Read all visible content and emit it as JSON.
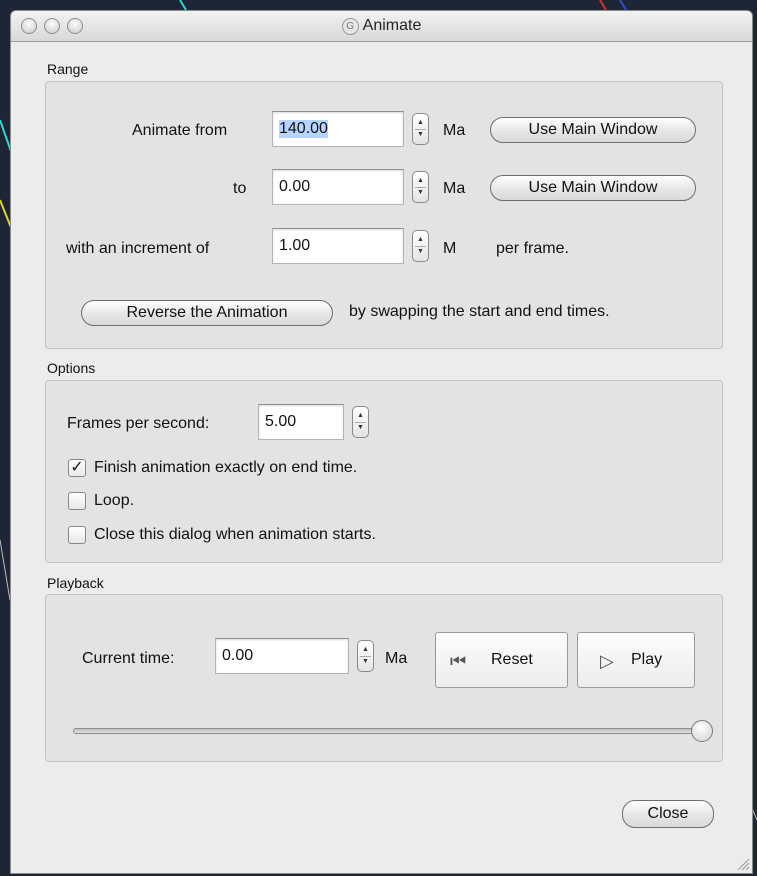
{
  "window": {
    "title": "Animate"
  },
  "range": {
    "label": "Range",
    "from_label": "Animate from",
    "from_value": "140.00",
    "from_unit": "Ma",
    "to_label": "to",
    "to_value": "0.00",
    "to_unit": "Ma",
    "use_main_window_label": "Use Main Window",
    "increment_label": "with an increment of",
    "increment_value": "1.00",
    "increment_unit": "M",
    "increment_suffix": "per frame.",
    "reverse_label": "Reverse the Animation",
    "reverse_desc": "by swapping the start and end times."
  },
  "options": {
    "label": "Options",
    "fps_label": "Frames per second:",
    "fps_value": "5.00",
    "finish_label": "Finish animation exactly on end time.",
    "finish_checked": true,
    "loop_label": "Loop.",
    "loop_checked": false,
    "close_on_start_label": "Close this dialog when animation starts.",
    "close_on_start_checked": false
  },
  "playback": {
    "label": "Playback",
    "current_time_label": "Current time:",
    "current_time_value": "0.00",
    "current_time_unit": "Ma",
    "reset_label": "Reset",
    "play_label": "Play",
    "slider_position": 1.0
  },
  "footer": {
    "close_label": "Close"
  }
}
